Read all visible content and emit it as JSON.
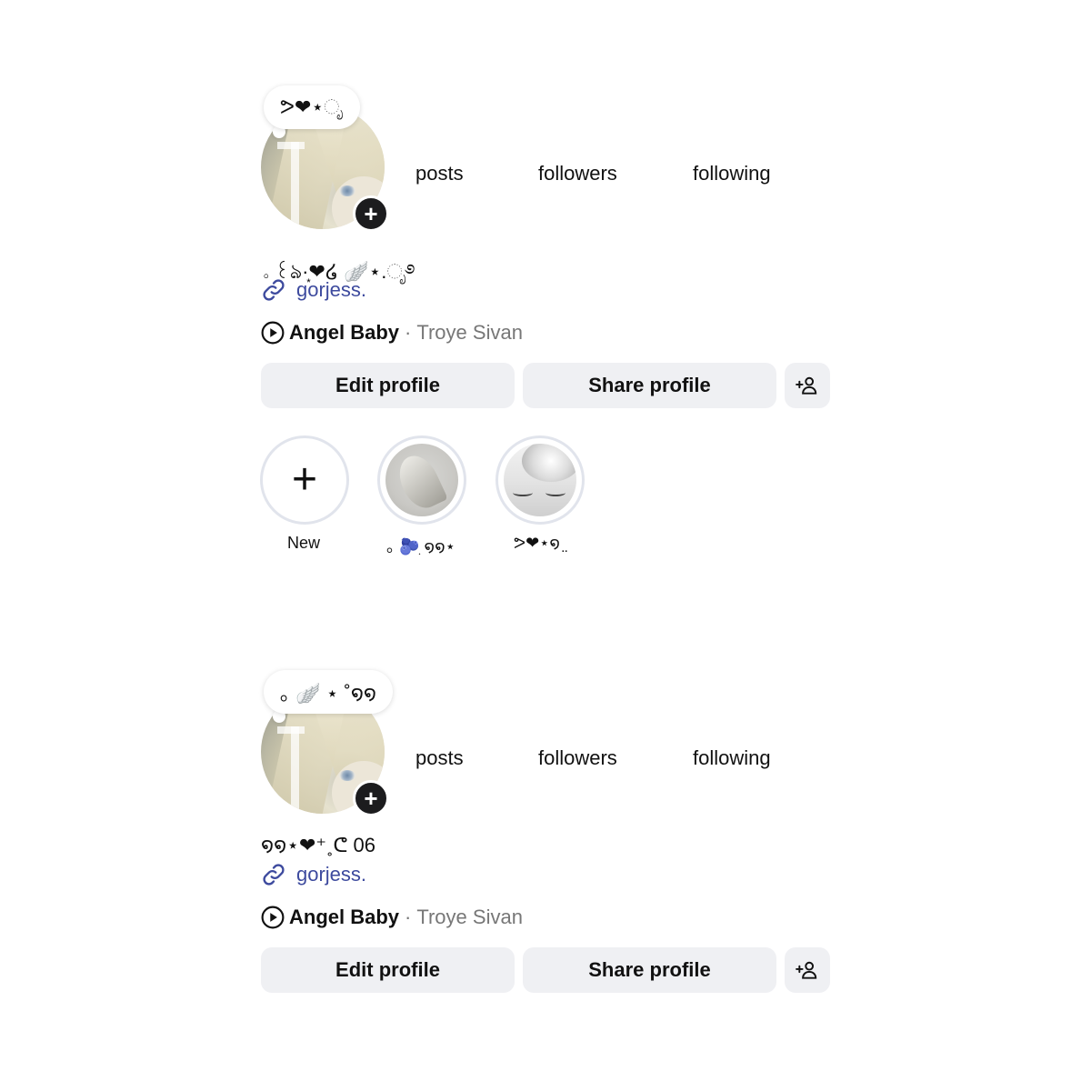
{
  "profiles": [
    {
      "note": "ᕗ❤︎⋆ೃ",
      "stats": {
        "posts_label": "posts",
        "followers_label": "followers",
        "following_label": "following"
      },
      "bio_name": "｡ ꒰ঌ·͙❤︎໒ 🪽⋆.ೃ࿔",
      "link": "gorjess.",
      "music": {
        "song": "Angel Baby",
        "separator": "·",
        "artist": "Troye Sivan"
      },
      "buttons": {
        "edit": "Edit profile",
        "share": "Share profile"
      },
      "highlights": [
        {
          "caption": "New"
        },
        {
          "caption": "｡ 🫐ִ ໑໑⋆"
        },
        {
          "caption": "ᕗ❤︎⋆໑ ̤"
        }
      ]
    },
    {
      "note": "｡ 🪽 ⋆ ˚໑໑",
      "stats": {
        "posts_label": "posts",
        "followers_label": "followers",
        "following_label": "following"
      },
      "bio_name": "໑໑⋆❤︎⁺˳ᕦ  06",
      "link": "gorjess.",
      "music": {
        "song": "Angel Baby",
        "separator": "·",
        "artist": "Troye Sivan"
      },
      "buttons": {
        "edit": "Edit profile",
        "share": "Share profile"
      }
    }
  ],
  "icons": {
    "link": "link-icon",
    "play": "play-circle-icon",
    "add_user": "add-user-icon",
    "add_story": "plus-icon"
  },
  "colors": {
    "link": "#3d4a9e",
    "button_bg": "#eff0f3",
    "badge": "#1c1c1e"
  }
}
